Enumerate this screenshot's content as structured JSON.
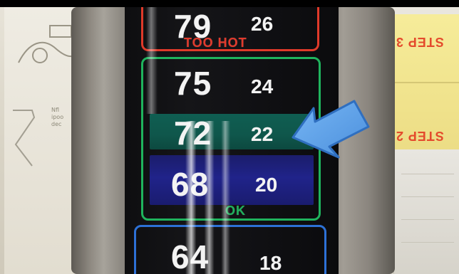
{
  "thermometer": {
    "rows": [
      {
        "f": "79",
        "c": "26"
      },
      {
        "f": "75",
        "c": "24"
      },
      {
        "f": "72",
        "c": "22"
      },
      {
        "f": "68",
        "c": "20"
      },
      {
        "f": "64",
        "c": "18"
      }
    ],
    "labels": {
      "too_hot": "TOO HOT",
      "ok": "OK"
    }
  },
  "card_labels": {
    "step_3": "STEP 3",
    "step_2": "STEP 2"
  },
  "background_text": {
    "left_snippet": "Nfl\nipoo\ndec"
  },
  "colors": {
    "too_hot": "#e03a2a",
    "ok": "#1fb35d",
    "cold_frame": "#2d71d6",
    "arrow_fill": "#5aa0ea",
    "highlight_band": "#0f5a4e",
    "blue_band": "#20238a",
    "card_yellow": "#f2e48c"
  },
  "annotation": {
    "icon": "arrow-pointer-icon",
    "target_row_index": 2
  }
}
